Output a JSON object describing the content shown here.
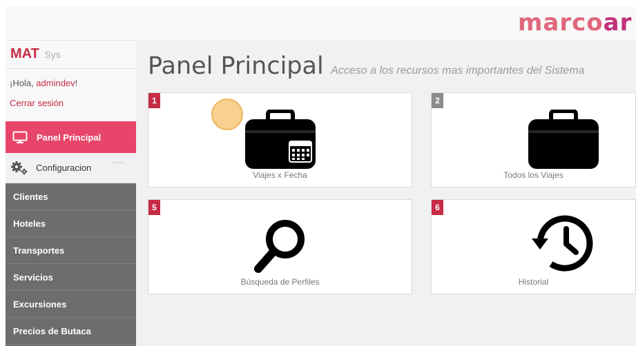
{
  "brand": {
    "part1": "marco",
    "part2": "ar",
    "color1": "#e0677c",
    "color2": "#c1317a"
  },
  "sidebar": {
    "logo": "MAT",
    "logo_suffix": "Sys",
    "greeting": "¡Hola, ",
    "username": "admindev",
    "greeting_end": "!",
    "logout": "Cerrar sesión",
    "active_item": {
      "label": "Panel Principal",
      "icon": "monitor-icon"
    },
    "config_item": {
      "label": "Configuracion",
      "icon": "gears-icon"
    },
    "menu": [
      {
        "label": "Clientes"
      },
      {
        "label": "Hoteles"
      },
      {
        "label": "Transportes"
      },
      {
        "label": "Servicios"
      },
      {
        "label": "Excursiones"
      },
      {
        "label": "Precios de Butaca"
      }
    ]
  },
  "main": {
    "title": "Panel Principal",
    "subtitle": "Acceso a los recursos mas importantes del Sistema",
    "tiles": [
      {
        "number": "1",
        "label": "Viajes x Fecha",
        "icon": "suitcase-calendar-icon",
        "badge_color": "#c62c46"
      },
      {
        "number": "2",
        "label": "Todos los Viajes",
        "icon": "suitcase-icon",
        "badge_color": "#8c8c8c"
      },
      {
        "number": "5",
        "label": "Búsqueda de Perfiles",
        "icon": "magnifier-icon",
        "badge_color": "#c62c46"
      },
      {
        "number": "6",
        "label": "Historial",
        "icon": "history-icon",
        "badge_color": "#c62c46"
      }
    ]
  },
  "colors": {
    "accent": "#e7456a",
    "sidebar_bg": "#6d6d6d",
    "main_bg": "#f1f1f1"
  }
}
